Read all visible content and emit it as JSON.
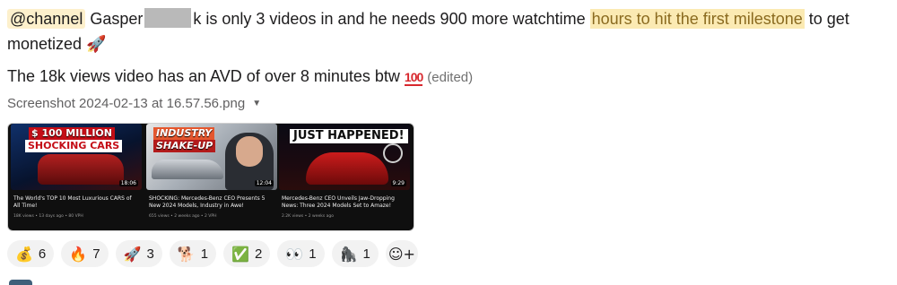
{
  "message": {
    "mention": "@channel",
    "name_part": "Gasper",
    "after_redact": "k is only 3 videos in and he needs 900 more watchtime",
    "highlight": "hours to hit the first milestone",
    "after_highlight": "to get",
    "line1b": "monetized",
    "rocket_emoji": "🚀",
    "line2": "The 18k views video has an AVD of over 8 minutes btw",
    "hundred_emoji": "100",
    "edited": "(edited)"
  },
  "attachment": {
    "filename": "Screenshot 2024-02-13 at 16.57.56.png",
    "caret": "▼",
    "cards": [
      {
        "overlay_a": "$ 100 MILLION",
        "overlay_b": "SHOCKING CARS",
        "duration": "18:06",
        "title": "The World's TOP 10 Most Luxurious CARS of All Time!",
        "meta": "18K views • 13 days ago • 80 VPH"
      },
      {
        "overlay_a": "INDUSTRY",
        "overlay_b": "SHAKE-UP",
        "duration": "12:04",
        "title": "SHOCKING: Mercedes-Benz CEO Presents 5 New 2024 Models, Industry in Awe!",
        "meta": "655 views • 2 weeks ago • 2 VPH"
      },
      {
        "overlay_a": "JUST HAPPENED!",
        "overlay_b": "",
        "duration": "9:29",
        "title": "Mercedes-Benz CEO Unveils Jaw-Dropping News: Three 2024 Models Set to Amaze!",
        "meta": "2.2K views • 2 weeks ago"
      }
    ]
  },
  "reactions": [
    {
      "icon": "money-bag-icon",
      "emoji": "💰",
      "count": "6"
    },
    {
      "icon": "fire-icon",
      "emoji": "🔥",
      "count": "7"
    },
    {
      "icon": "rocket-icon",
      "emoji": "🚀",
      "count": "3"
    },
    {
      "icon": "doge-icon",
      "emoji": "🐕",
      "count": "1"
    },
    {
      "icon": "check-mark-icon",
      "emoji": "✅",
      "count": "2"
    },
    {
      "icon": "eyes-icon",
      "emoji": "👀",
      "count": "1"
    },
    {
      "icon": "gorilla-icon",
      "emoji": "🦍",
      "count": "1"
    }
  ],
  "add_reaction": {
    "emoji": "☺+"
  }
}
